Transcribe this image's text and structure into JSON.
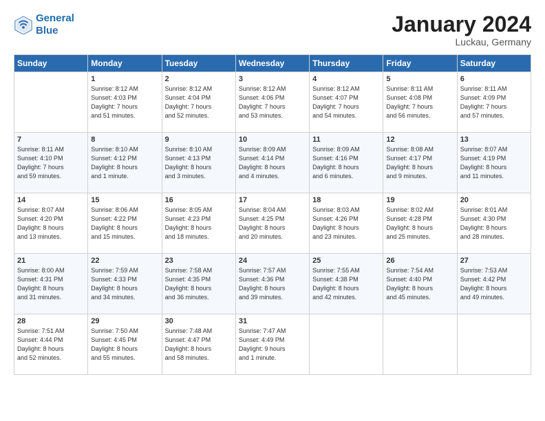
{
  "header": {
    "logo_line1": "General",
    "logo_line2": "Blue",
    "month": "January 2024",
    "location": "Luckau, Germany"
  },
  "days_of_week": [
    "Sunday",
    "Monday",
    "Tuesday",
    "Wednesday",
    "Thursday",
    "Friday",
    "Saturday"
  ],
  "weeks": [
    [
      {
        "day": "",
        "info": ""
      },
      {
        "day": "1",
        "info": "Sunrise: 8:12 AM\nSunset: 4:03 PM\nDaylight: 7 hours\nand 51 minutes."
      },
      {
        "day": "2",
        "info": "Sunrise: 8:12 AM\nSunset: 4:04 PM\nDaylight: 7 hours\nand 52 minutes."
      },
      {
        "day": "3",
        "info": "Sunrise: 8:12 AM\nSunset: 4:06 PM\nDaylight: 7 hours\nand 53 minutes."
      },
      {
        "day": "4",
        "info": "Sunrise: 8:12 AM\nSunset: 4:07 PM\nDaylight: 7 hours\nand 54 minutes."
      },
      {
        "day": "5",
        "info": "Sunrise: 8:11 AM\nSunset: 4:08 PM\nDaylight: 7 hours\nand 56 minutes."
      },
      {
        "day": "6",
        "info": "Sunrise: 8:11 AM\nSunset: 4:09 PM\nDaylight: 7 hours\nand 57 minutes."
      }
    ],
    [
      {
        "day": "7",
        "info": "Sunrise: 8:11 AM\nSunset: 4:10 PM\nDaylight: 7 hours\nand 59 minutes."
      },
      {
        "day": "8",
        "info": "Sunrise: 8:10 AM\nSunset: 4:12 PM\nDaylight: 8 hours\nand 1 minute."
      },
      {
        "day": "9",
        "info": "Sunrise: 8:10 AM\nSunset: 4:13 PM\nDaylight: 8 hours\nand 3 minutes."
      },
      {
        "day": "10",
        "info": "Sunrise: 8:09 AM\nSunset: 4:14 PM\nDaylight: 8 hours\nand 4 minutes."
      },
      {
        "day": "11",
        "info": "Sunrise: 8:09 AM\nSunset: 4:16 PM\nDaylight: 8 hours\nand 6 minutes."
      },
      {
        "day": "12",
        "info": "Sunrise: 8:08 AM\nSunset: 4:17 PM\nDaylight: 8 hours\nand 9 minutes."
      },
      {
        "day": "13",
        "info": "Sunrise: 8:07 AM\nSunset: 4:19 PM\nDaylight: 8 hours\nand 11 minutes."
      }
    ],
    [
      {
        "day": "14",
        "info": "Sunrise: 8:07 AM\nSunset: 4:20 PM\nDaylight: 8 hours\nand 13 minutes."
      },
      {
        "day": "15",
        "info": "Sunrise: 8:06 AM\nSunset: 4:22 PM\nDaylight: 8 hours\nand 15 minutes."
      },
      {
        "day": "16",
        "info": "Sunrise: 8:05 AM\nSunset: 4:23 PM\nDaylight: 8 hours\nand 18 minutes."
      },
      {
        "day": "17",
        "info": "Sunrise: 8:04 AM\nSunset: 4:25 PM\nDaylight: 8 hours\nand 20 minutes."
      },
      {
        "day": "18",
        "info": "Sunrise: 8:03 AM\nSunset: 4:26 PM\nDaylight: 8 hours\nand 23 minutes."
      },
      {
        "day": "19",
        "info": "Sunrise: 8:02 AM\nSunset: 4:28 PM\nDaylight: 8 hours\nand 25 minutes."
      },
      {
        "day": "20",
        "info": "Sunrise: 8:01 AM\nSunset: 4:30 PM\nDaylight: 8 hours\nand 28 minutes."
      }
    ],
    [
      {
        "day": "21",
        "info": "Sunrise: 8:00 AM\nSunset: 4:31 PM\nDaylight: 8 hours\nand 31 minutes."
      },
      {
        "day": "22",
        "info": "Sunrise: 7:59 AM\nSunset: 4:33 PM\nDaylight: 8 hours\nand 34 minutes."
      },
      {
        "day": "23",
        "info": "Sunrise: 7:58 AM\nSunset: 4:35 PM\nDaylight: 8 hours\nand 36 minutes."
      },
      {
        "day": "24",
        "info": "Sunrise: 7:57 AM\nSunset: 4:36 PM\nDaylight: 8 hours\nand 39 minutes."
      },
      {
        "day": "25",
        "info": "Sunrise: 7:55 AM\nSunset: 4:38 PM\nDaylight: 8 hours\nand 42 minutes."
      },
      {
        "day": "26",
        "info": "Sunrise: 7:54 AM\nSunset: 4:40 PM\nDaylight: 8 hours\nand 45 minutes."
      },
      {
        "day": "27",
        "info": "Sunrise: 7:53 AM\nSunset: 4:42 PM\nDaylight: 8 hours\nand 49 minutes."
      }
    ],
    [
      {
        "day": "28",
        "info": "Sunrise: 7:51 AM\nSunset: 4:44 PM\nDaylight: 8 hours\nand 52 minutes."
      },
      {
        "day": "29",
        "info": "Sunrise: 7:50 AM\nSunset: 4:45 PM\nDaylight: 8 hours\nand 55 minutes."
      },
      {
        "day": "30",
        "info": "Sunrise: 7:48 AM\nSunset: 4:47 PM\nDaylight: 8 hours\nand 58 minutes."
      },
      {
        "day": "31",
        "info": "Sunrise: 7:47 AM\nSunset: 4:49 PM\nDaylight: 9 hours\nand 1 minute."
      },
      {
        "day": "",
        "info": ""
      },
      {
        "day": "",
        "info": ""
      },
      {
        "day": "",
        "info": ""
      }
    ]
  ]
}
